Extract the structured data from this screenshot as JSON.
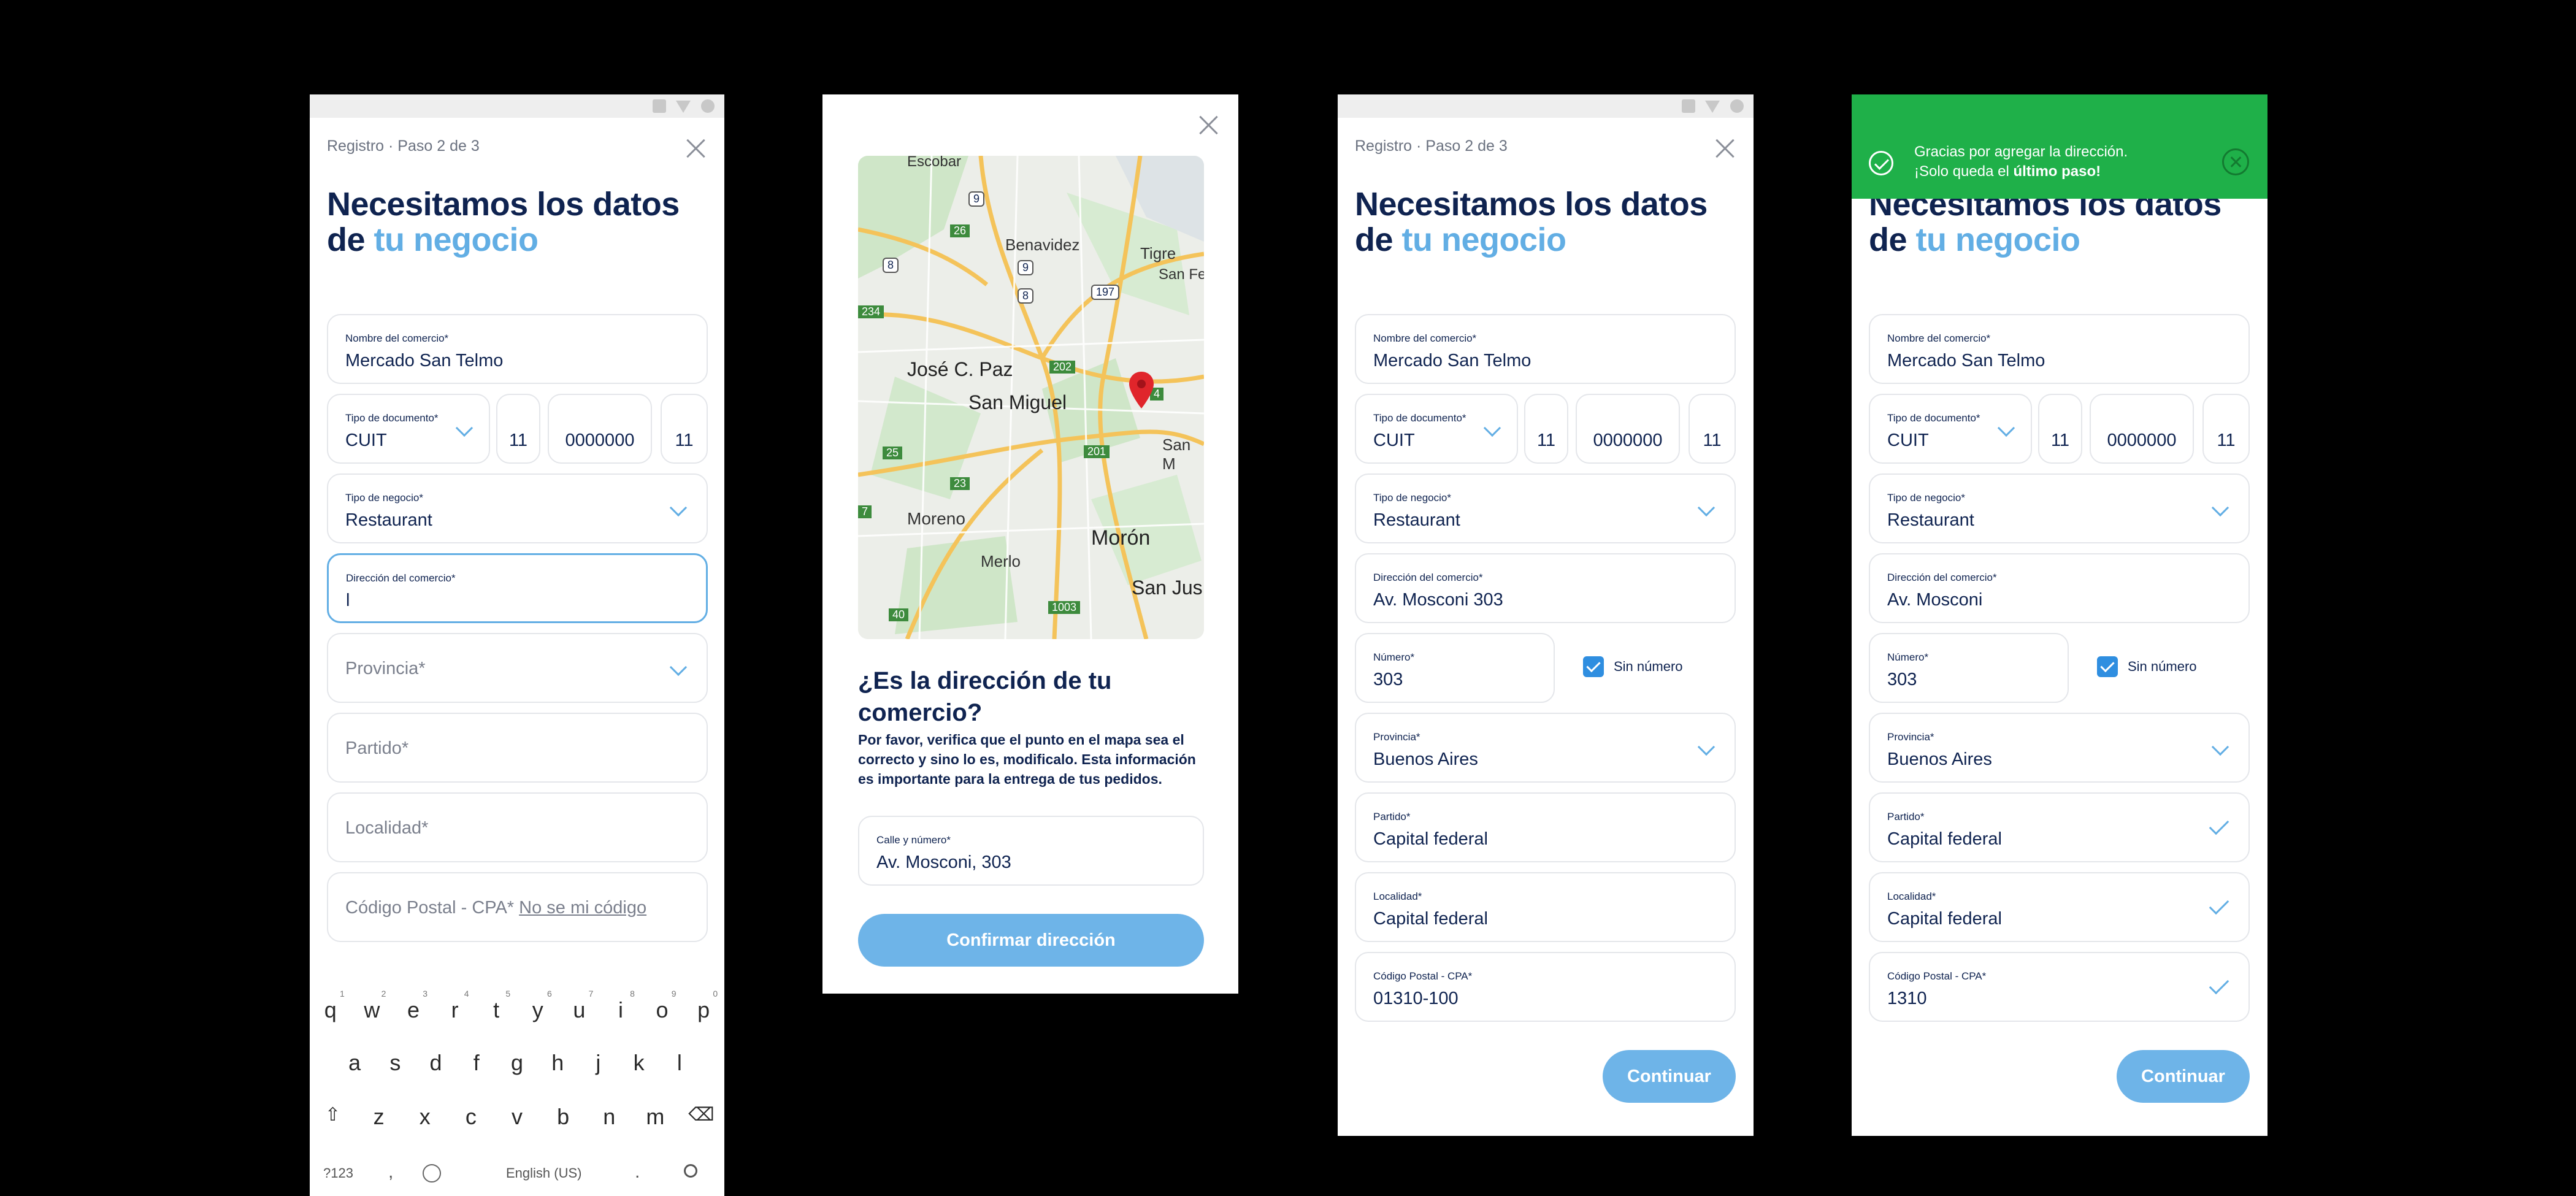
{
  "common": {
    "step": "Registro · Paso 2 de 3",
    "heading_line1": "Necesitamos los datos",
    "heading_de": "de ",
    "heading_accent": "tu negocio",
    "sin_numero": "Sin número",
    "continue": "Continuar"
  },
  "labels": {
    "nombre": "Nombre del comercio*",
    "tipo_doc": "Tipo de documento*",
    "tipo_negocio": "Tipo de negocio*",
    "direccion": "Dirección del comercio*",
    "numero": "Número*",
    "provincia": "Provincia*",
    "partido": "Partido*",
    "localidad": "Localidad*",
    "cp": "Código Postal - CPA*"
  },
  "s1": {
    "nombre": "Mercado San Telmo",
    "tipo_doc": "CUIT",
    "doc_a": "11",
    "doc_b": "0000000",
    "doc_c": "11",
    "tipo_negocio": "Restaurant",
    "direccion": "l",
    "provincia_ph": "Provincia*",
    "partido_ph": "Partido*",
    "localidad_ph": "Localidad*",
    "cp_ph": "Código Postal - CPA*",
    "cp_link": "No se mi código"
  },
  "keyboard": {
    "row1": [
      "q",
      "w",
      "e",
      "r",
      "t",
      "y",
      "u",
      "i",
      "o",
      "p"
    ],
    "row1_nums": [
      "1",
      "2",
      "3",
      "4",
      "5",
      "6",
      "7",
      "8",
      "9",
      "0"
    ],
    "row2": [
      "a",
      "s",
      "d",
      "f",
      "g",
      "h",
      "j",
      "k",
      "l"
    ],
    "row3": [
      "z",
      "x",
      "c",
      "v",
      "b",
      "n",
      "m"
    ],
    "sym": "?123",
    "comma": ",",
    "space": "English (US)",
    "period": "."
  },
  "s2": {
    "map_places": [
      "Escobar",
      "Benavidez",
      "Tigre",
      "San Fernando",
      "José C. Paz",
      "San Miguel",
      "San M",
      "Moreno",
      "Merlo",
      "Morón",
      "San Jus"
    ],
    "map_routes": [
      "9",
      "26",
      "8",
      "9",
      "8",
      "197",
      "234",
      "202",
      "4",
      "201",
      "25",
      "23",
      "7",
      "1003",
      "40"
    ],
    "title_l1": "¿Es la dirección de tu",
    "title_l2": "comercio?",
    "text": "Por favor, verifica que el punto en el mapa sea el correcto y sino lo es, modificalo. Esta información es importante para la entrega de tus pedidos.",
    "calle_label": "Calle y número*",
    "calle_value": "Av. Mosconi, 303",
    "confirm": "Confirmar dirección"
  },
  "s3": {
    "nombre": "Mercado San Telmo",
    "tipo_doc": "CUIT",
    "doc_a": "11",
    "doc_b": "0000000",
    "doc_c": "11",
    "tipo_negocio": "Restaurant",
    "direccion": "Av. Mosconi 303",
    "numero": "303",
    "provincia": "Buenos Aires",
    "partido": "Capital federal",
    "localidad": "Capital federal",
    "cp": "01310-100"
  },
  "s4": {
    "toast_l1": "Gracias por agregar la dirección.",
    "toast_l2a": "¡Solo queda el ",
    "toast_l2b": "último paso!",
    "nombre": "Mercado San Telmo",
    "tipo_doc": "CUIT",
    "doc_a": "11",
    "doc_b": "0000000",
    "doc_c": "11",
    "tipo_negocio": "Restaurant",
    "direccion": "Av. Mosconi",
    "numero": "303",
    "provincia": "Buenos Aires",
    "partido": "Capital federal",
    "localidad": "Capital federal",
    "cp": "1310"
  },
  "colors": {
    "primary": "#0f2350",
    "accent": "#62aee4",
    "button": "#6eb4e8",
    "success": "#1fb049"
  }
}
